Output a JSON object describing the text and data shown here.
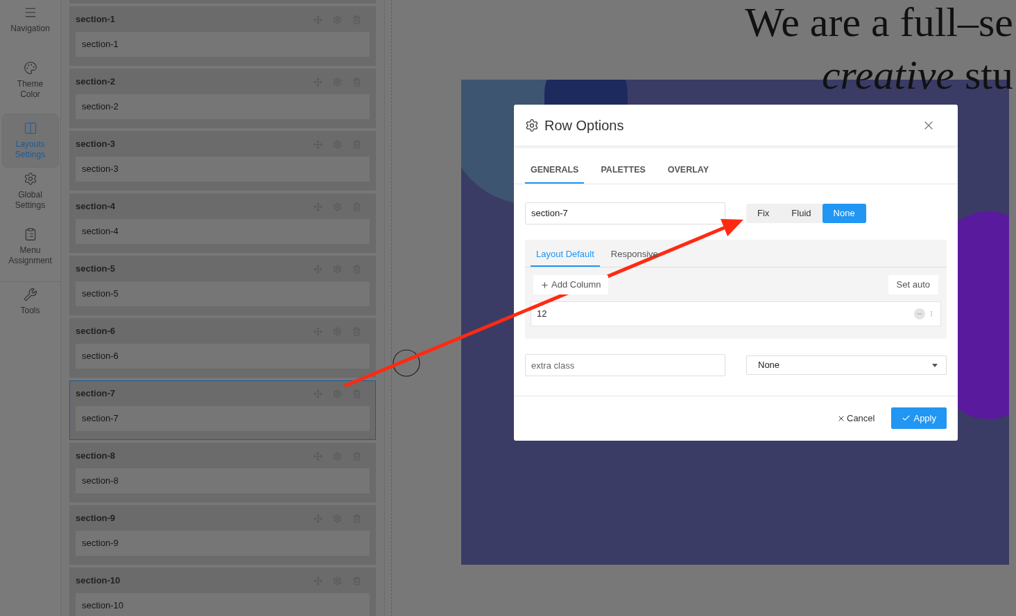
{
  "sidebar": {
    "items": [
      {
        "label": "Navigation",
        "selected": false
      },
      {
        "label": "Theme Color",
        "selected": false
      },
      {
        "label": "Layouts Settings",
        "selected": true
      },
      {
        "label": "Global Settings",
        "selected": false
      },
      {
        "label": "Menu Assignment",
        "selected": false
      },
      {
        "label": "Tools",
        "selected": false
      }
    ]
  },
  "sections": [
    {
      "title": "section-1",
      "value": "section-1",
      "selected": false
    },
    {
      "title": "section-2",
      "value": "section-2",
      "selected": false
    },
    {
      "title": "section-3",
      "value": "section-3",
      "selected": false
    },
    {
      "title": "section-4",
      "value": "section-4",
      "selected": false
    },
    {
      "title": "section-5",
      "value": "section-5",
      "selected": false
    },
    {
      "title": "section-6",
      "value": "section-6",
      "selected": false
    },
    {
      "title": "section-7",
      "value": "section-7",
      "selected": true
    },
    {
      "title": "section-8",
      "value": "section-8",
      "selected": false
    },
    {
      "title": "section-9",
      "value": "section-9",
      "selected": false
    },
    {
      "title": "section-10",
      "value": "section-10",
      "selected": false
    }
  ],
  "canvas": {
    "heading_line_1": "We are a full–se",
    "heading_line_2": "*creative* stu"
  },
  "dialog": {
    "title": "Row Options",
    "tabs": [
      {
        "label": "GENERALS",
        "selected": true
      },
      {
        "label": "PALETTES",
        "selected": false
      },
      {
        "label": "OVERLAY",
        "selected": false
      }
    ],
    "name_field": {
      "value": "section-7"
    },
    "width_options": [
      {
        "label": "Fix",
        "selected": false
      },
      {
        "label": "Fluid",
        "selected": false
      },
      {
        "label": "None",
        "selected": true
      }
    ],
    "layout_tabs": [
      {
        "label": "Layout Default",
        "selected": true
      },
      {
        "label": "Responsive",
        "selected": false
      }
    ],
    "add_column_button": "Add Column",
    "set_auto_button": "Set auto",
    "columns": [
      {
        "value": "12"
      }
    ],
    "extra_class": {
      "placeholder": "extra class"
    },
    "select": {
      "value": "None"
    },
    "cancel_button": "Cancel",
    "apply_button": "Apply"
  }
}
